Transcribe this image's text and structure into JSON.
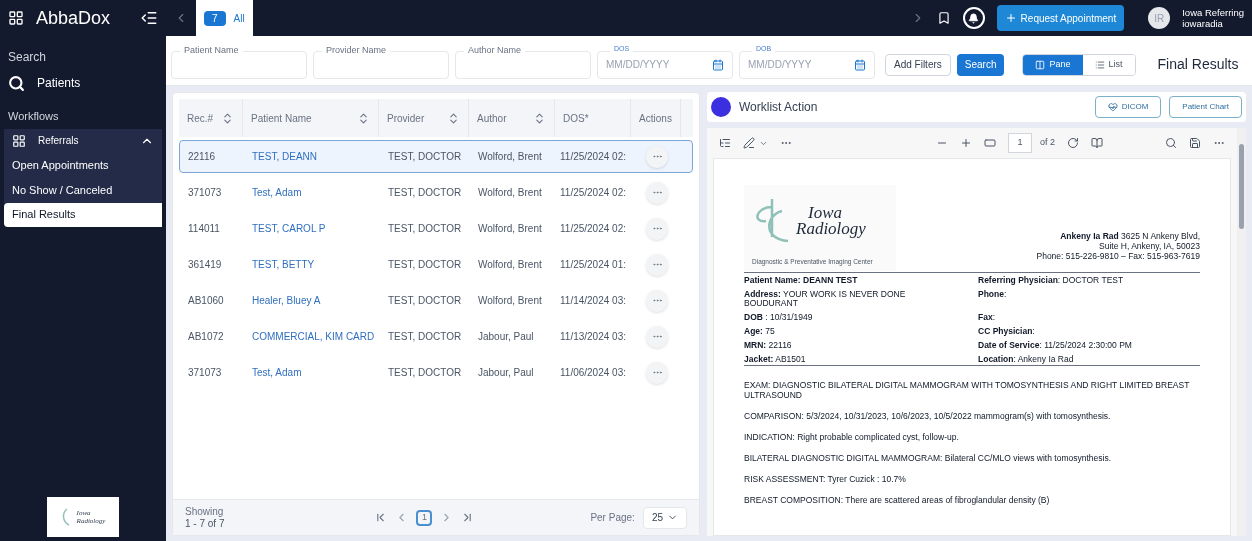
{
  "app": {
    "logo": "AbbaDox"
  },
  "top_bar": {
    "count": "7",
    "filter": "All",
    "request_button": "Request Appointment",
    "user": {
      "initials": "IR",
      "name": "Iowa Referring",
      "login": "iowaradia"
    }
  },
  "sidebar": {
    "search_heading": "Search",
    "search_item": "Patients",
    "workflows_heading": "Workflows",
    "group": {
      "label": "Referrals",
      "expanded": true
    },
    "items": [
      {
        "label": "Open Appointments",
        "selected": false
      },
      {
        "label": "No Show / Canceled",
        "selected": false
      },
      {
        "label": "Final Results",
        "selected": true
      }
    ],
    "footer_logo": {
      "name": "Iowa",
      "name2": "Radiology"
    }
  },
  "filters": {
    "fields": [
      {
        "label": "Patient Name",
        "kind": "text"
      },
      {
        "label": "Provider Name",
        "kind": "text"
      },
      {
        "label": "Author Name",
        "kind": "text"
      },
      {
        "label": "DOS",
        "kind": "date",
        "placeholder": "MM/DD/YYYY"
      },
      {
        "label": "DOB",
        "kind": "date",
        "placeholder": "MM/DD/YYYY"
      }
    ],
    "add_filters": "Add Filters",
    "search": "Search",
    "views": [
      {
        "label": "Pane",
        "selected": true
      },
      {
        "label": "List",
        "selected": false
      }
    ],
    "page_title": "Final Results"
  },
  "table": {
    "columns": [
      {
        "label": "Rec.#",
        "sortable": true
      },
      {
        "label": "Patient Name",
        "sortable": true
      },
      {
        "label": "Provider",
        "sortable": true
      },
      {
        "label": "Author",
        "sortable": true
      },
      {
        "label": "DOS*",
        "sortable": false
      },
      {
        "label": "Actions",
        "sortable": false
      }
    ],
    "rows": [
      {
        "rec": "22116",
        "patient": "TEST, DEANN",
        "provider": "TEST, DOCTOR",
        "author": "Wolford, Brent",
        "dos": "11/25/2024 02:",
        "selected": true
      },
      {
        "rec": "371073",
        "patient": "Test, Adam",
        "provider": "TEST, DOCTOR",
        "author": "Wolford, Brent",
        "dos": "11/25/2024 02:",
        "selected": false
      },
      {
        "rec": "114011",
        "patient": "TEST, CAROL P",
        "provider": "TEST, DOCTOR",
        "author": "Wolford, Brent",
        "dos": "11/25/2024 02:",
        "selected": false
      },
      {
        "rec": "361419",
        "patient": "TEST, BETTY",
        "provider": "TEST, DOCTOR",
        "author": "Wolford, Brent",
        "dos": "11/25/2024 01:",
        "selected": false
      },
      {
        "rec": "AB1060",
        "patient": "Healer, Bluey A",
        "provider": "TEST, DOCTOR",
        "author": "Wolford, Brent",
        "dos": "11/14/2024 03:",
        "selected": false
      },
      {
        "rec": "AB1072",
        "patient": "COMMERCIAL, KIM CARD",
        "provider": "TEST, DOCTOR",
        "author": "Jabour, Paul",
        "dos": "11/13/2024 03:",
        "selected": false
      },
      {
        "rec": "371073",
        "patient": "Test, Adam",
        "provider": "TEST, DOCTOR",
        "author": "Jabour, Paul",
        "dos": "11/06/2024 03:",
        "selected": false
      }
    ],
    "footer": {
      "showing": "Showing",
      "range": "1 - 7 of 7",
      "page": "1",
      "per_page_label": "Per Page:",
      "per_page": "25"
    }
  },
  "worklist": {
    "title": "Worklist Action",
    "buttons": [
      "DICOM",
      "Patient Chart"
    ]
  },
  "viewer": {
    "page": "1",
    "of": "of 2",
    "document": {
      "logo": {
        "line1": "Iowa",
        "line2": "Radiology",
        "tagline": "Diagnostic & Preventative Imaging Center"
      },
      "address": [
        {
          "bold": "Ankeny Ia Rad",
          "text": " 3625 N Ankeny Blvd,"
        },
        {
          "text": "Suite H, Ankeny, IA, 50023"
        },
        {
          "text": "Phone: 515-226-9810 – Fax: 515-963-7619"
        }
      ],
      "left_fields": [
        {
          "label": "Patient Name:",
          "value": "DEANN TEST",
          "bold_value": true
        },
        {
          "label": "Address:",
          "value": "YOUR WORK IS NEVER DONE BOUDURANT",
          "bold_value": false
        },
        {
          "label": "DOB",
          "value": ": 10/31/1949",
          "bold_value": false
        },
        {
          "label": "Age:",
          "value": "75",
          "bold_value": false
        },
        {
          "label": "MRN:",
          "value": "22116",
          "bold_value": false
        },
        {
          "label": "Jacket:",
          "value": "AB1501",
          "bold_value": false
        }
      ],
      "right_fields": [
        {
          "label": "Referring Physician",
          "value": ": DOCTOR TEST"
        },
        {
          "label": "Phone",
          "value": ":"
        },
        {
          "label": "Fax",
          "value": ":"
        },
        {
          "label": "CC Physician",
          "value": ":"
        },
        {
          "label": "Date of Service",
          "value": ": 11/25/2024 2:30:00 PM"
        },
        {
          "label": "Location",
          "value": ": Ankeny Ia Rad"
        }
      ],
      "paragraphs": [
        "EXAM: DIAGNOSTIC BILATERAL DIGITAL MAMMOGRAM WITH TOMOSYNTHESIS AND RIGHT LIMITED BREAST ULTRASOUND",
        "COMPARISON: 5/3/2024, 10/31/2023, 10/6/2023, 10/5/2022 mammogram(s) with tomosynthesis.",
        "INDICATION: Right probable complicated cyst, follow-up.",
        "BILATERAL DIAGNOSTIC DIGITAL MAMMOGRAM: Bilateral CC/MLO views with tomosynthesis.",
        "RISK ASSESSMENT: Tyrer Cuzick : 10.7%",
        "BREAST COMPOSITION: There are scattered areas of fibroglandular density (B)"
      ]
    }
  }
}
